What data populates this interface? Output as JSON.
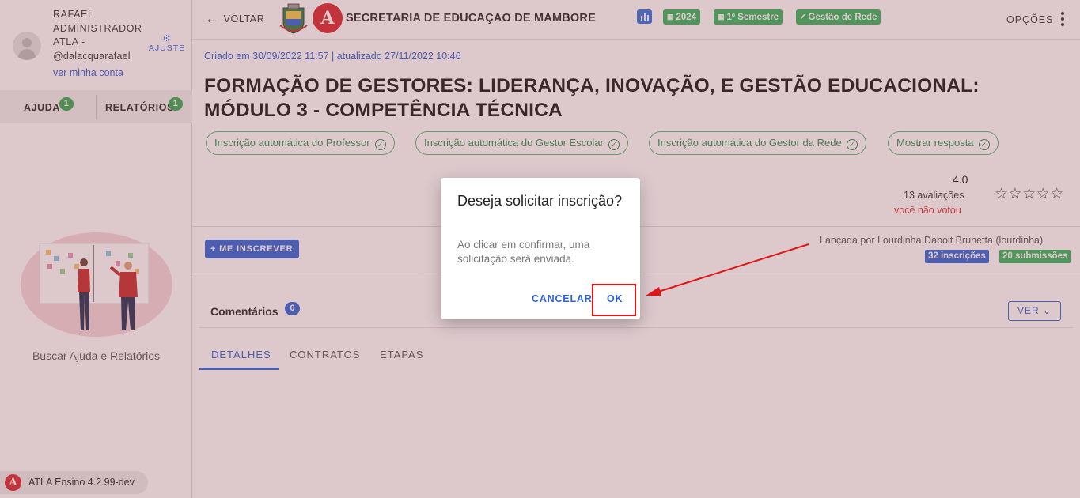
{
  "user": {
    "name": "RAFAEL ADMINISTRADOR ATLA -",
    "handle": "@dalacquarafael",
    "account_link": "ver minha conta",
    "settings_label": "AJUSTE"
  },
  "sidebar": {
    "tabs": [
      {
        "label": "AJUDA",
        "badge": "1"
      },
      {
        "label": "RELATÓRIOS",
        "badge": "1"
      }
    ],
    "help_text": "Buscar Ajuda e Relatórios",
    "version": "ATLA Ensino 4.2.99-dev"
  },
  "header": {
    "back_label": "VOLTAR",
    "org_title": "SECRETARIA DE EDUCAÇAO DE MAMBORE",
    "chips": [
      {
        "label": "2024",
        "icon": "calendar-icon"
      },
      {
        "label": "1º Semestre",
        "icon": "calendar-icon"
      },
      {
        "label": "Gestão de Rede",
        "icon": "check-circle-icon"
      }
    ],
    "options_label": "OPÇÕES"
  },
  "course": {
    "meta": "Criado em 30/09/2022 11:57 | atualizado 27/11/2022 10:46",
    "title": "FORMAÇÃO DE GESTORES: LIDERANÇA, INOVAÇÃO, E GESTÃO EDUCACIONAL: MÓDULO 3 - COMPETÊNCIA TÉCNICA",
    "options": [
      "Inscrição automática do Professor",
      "Inscrição automática do Gestor Escolar",
      "Inscrição automática do Gestor da Rede",
      "Mostrar resposta"
    ],
    "rating": {
      "value": "4.0",
      "count": "13 avaliações",
      "vote_status": "você não votou",
      "stars": "☆☆☆☆☆"
    },
    "enroll_label": "ME INSCREVER",
    "launched_by": "Lançada por Lourdinha Daboit Brunetta (lourdinha)",
    "enrollments": "32 inscrições",
    "submissions": "20 submissões",
    "comments_label": "Comentários",
    "comments_count": "0",
    "ver_label": "VER",
    "tabs": [
      "DETALHES",
      "CONTRATOS",
      "ETAPAS"
    ]
  },
  "dialog": {
    "title": "Deseja solicitar inscrição?",
    "text": "Ao clicar em confirmar, uma solicitação será enviada.",
    "cancel_label": "CANCELAR",
    "ok_label": "OK"
  },
  "colors": {
    "primary": "#2b62d6",
    "success": "#2fb35a",
    "brand_red": "#d8232a",
    "annotation": "#e01515"
  }
}
